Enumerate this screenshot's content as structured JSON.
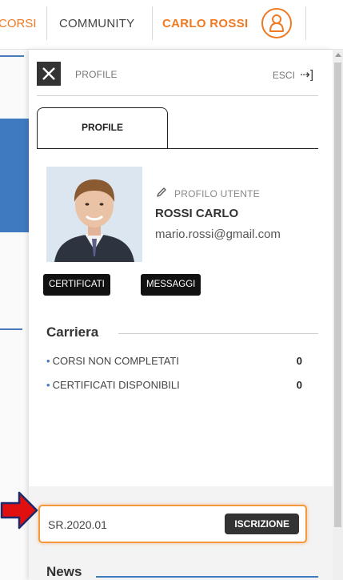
{
  "topnav": {
    "corsi_label": "CORSI",
    "community_label": "COMMUNITY",
    "user_label": "CARLO ROSSI"
  },
  "panel": {
    "title": "PROFILE",
    "esci_label": "ESCI",
    "tab_label": "PROFILE",
    "profilo_utente_label": "PROFILO UTENTE",
    "user_name": "ROSSI CARLO",
    "user_email": "mario.rossi@gmail.com",
    "certificati_label": "CERTIFICATI",
    "messaggi_label": "MESSAGGI",
    "carriera": {
      "title": "Carriera",
      "stats": [
        {
          "label": "CORSI NON COMPLETATI",
          "value": "0"
        },
        {
          "label": "CERTIFICATI DISPONIBILI",
          "value": "0"
        }
      ]
    },
    "code_input_value": "SR.2020.01",
    "iscrizione_label": "ISCRIZIONE",
    "news_title": "News"
  },
  "colors": {
    "accent_orange": "#f07a22",
    "accent_blue": "#3f7ac0",
    "arrow_red": "#e01010"
  }
}
